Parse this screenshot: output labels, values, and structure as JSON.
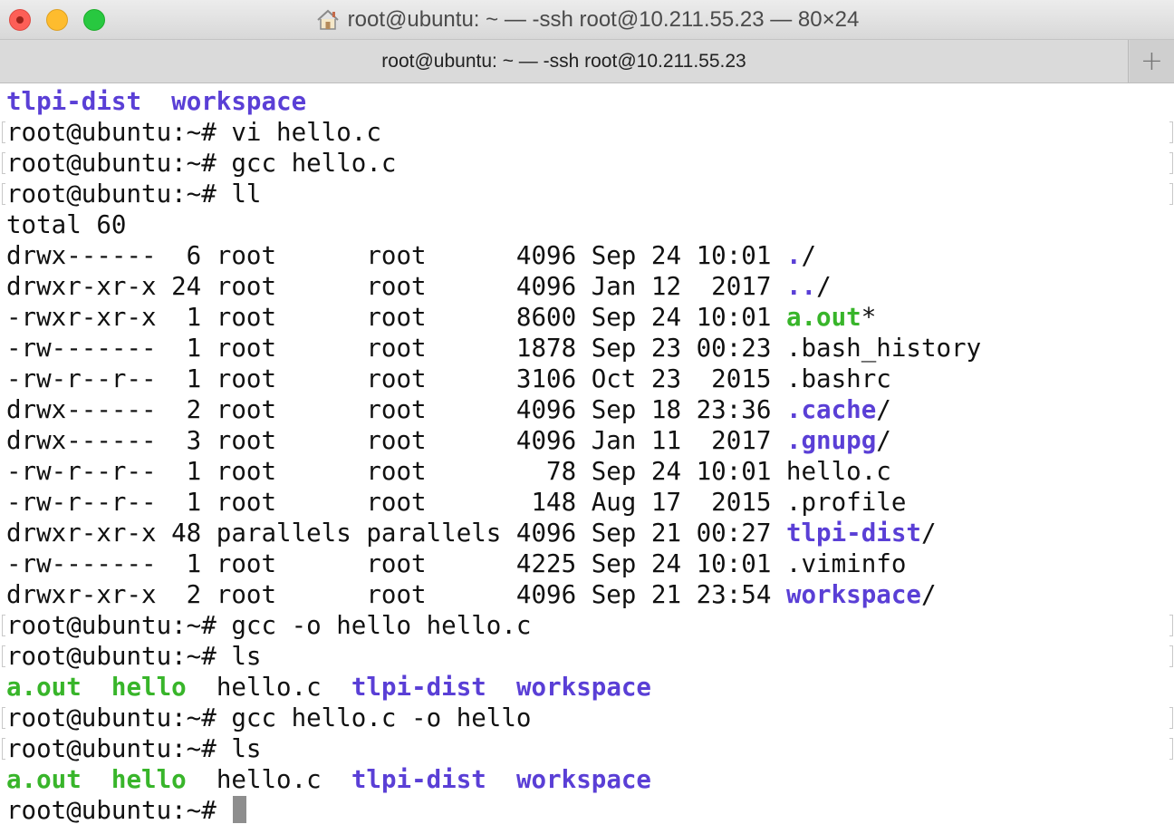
{
  "window": {
    "title": "root@ubuntu: ~ — -ssh root@10.211.55.23 — 80×24",
    "tab_label": "root@ubuntu: ~ — -ssh root@10.211.55.23",
    "new_tab_label": "+"
  },
  "colors": {
    "directory": "#5a3fd6",
    "executable": "#38b52a",
    "text": "#111111"
  },
  "terminal": {
    "lines": [
      {
        "marks": false,
        "segments": [
          {
            "t": "tlpi-dist",
            "c": "blue"
          },
          {
            "t": "  "
          },
          {
            "t": "workspace",
            "c": "blue"
          }
        ]
      },
      {
        "marks": true,
        "segments": [
          {
            "t": "root@ubuntu:~# vi hello.c"
          }
        ]
      },
      {
        "marks": true,
        "segments": [
          {
            "t": "root@ubuntu:~# gcc hello.c"
          }
        ]
      },
      {
        "marks": true,
        "segments": [
          {
            "t": "root@ubuntu:~# ll"
          }
        ]
      },
      {
        "marks": false,
        "segments": [
          {
            "t": "total 60"
          }
        ]
      },
      {
        "marks": false,
        "segments": [
          {
            "t": "drwx------  6 root      root      4096 Sep 24 10:01 "
          },
          {
            "t": ".",
            "c": "blue"
          },
          {
            "t": "/"
          }
        ]
      },
      {
        "marks": false,
        "segments": [
          {
            "t": "drwxr-xr-x 24 root      root      4096 Jan 12  2017 "
          },
          {
            "t": "..",
            "c": "blue"
          },
          {
            "t": "/"
          }
        ]
      },
      {
        "marks": false,
        "segments": [
          {
            "t": "-rwxr-xr-x  1 root      root      8600 Sep 24 10:01 "
          },
          {
            "t": "a.out",
            "c": "green"
          },
          {
            "t": "*"
          }
        ]
      },
      {
        "marks": false,
        "segments": [
          {
            "t": "-rw-------  1 root      root      1878 Sep 23 00:23 .bash_history"
          }
        ]
      },
      {
        "marks": false,
        "segments": [
          {
            "t": "-rw-r--r--  1 root      root      3106 Oct 23  2015 .bashrc"
          }
        ]
      },
      {
        "marks": false,
        "segments": [
          {
            "t": "drwx------  2 root      root      4096 Sep 18 23:36 "
          },
          {
            "t": ".cache",
            "c": "blue"
          },
          {
            "t": "/"
          }
        ]
      },
      {
        "marks": false,
        "segments": [
          {
            "t": "drwx------  3 root      root      4096 Jan 11  2017 "
          },
          {
            "t": ".gnupg",
            "c": "blue"
          },
          {
            "t": "/"
          }
        ]
      },
      {
        "marks": false,
        "segments": [
          {
            "t": "-rw-r--r--  1 root      root        78 Sep 24 10:01 hello.c"
          }
        ]
      },
      {
        "marks": false,
        "segments": [
          {
            "t": "-rw-r--r--  1 root      root       148 Aug 17  2015 .profile"
          }
        ]
      },
      {
        "marks": false,
        "segments": [
          {
            "t": "drwxr-xr-x 48 parallels parallels 4096 Sep 21 00:27 "
          },
          {
            "t": "tlpi-dist",
            "c": "blue"
          },
          {
            "t": "/"
          }
        ]
      },
      {
        "marks": false,
        "segments": [
          {
            "t": "-rw-------  1 root      root      4225 Sep 24 10:01 .viminfo"
          }
        ]
      },
      {
        "marks": false,
        "segments": [
          {
            "t": "drwxr-xr-x  2 root      root      4096 Sep 21 23:54 "
          },
          {
            "t": "workspace",
            "c": "blue"
          },
          {
            "t": "/"
          }
        ]
      },
      {
        "marks": true,
        "segments": [
          {
            "t": "root@ubuntu:~# gcc -o hello hello.c"
          }
        ]
      },
      {
        "marks": true,
        "segments": [
          {
            "t": "root@ubuntu:~# ls"
          }
        ]
      },
      {
        "marks": false,
        "segments": [
          {
            "t": "a.out",
            "c": "green"
          },
          {
            "t": "  "
          },
          {
            "t": "hello",
            "c": "green"
          },
          {
            "t": "  hello.c  "
          },
          {
            "t": "tlpi-dist",
            "c": "blue"
          },
          {
            "t": "  "
          },
          {
            "t": "workspace",
            "c": "blue"
          }
        ]
      },
      {
        "marks": true,
        "segments": [
          {
            "t": "root@ubuntu:~# gcc hello.c -o hello"
          }
        ]
      },
      {
        "marks": true,
        "segments": [
          {
            "t": "root@ubuntu:~# ls"
          }
        ]
      },
      {
        "marks": false,
        "segments": [
          {
            "t": "a.out",
            "c": "green"
          },
          {
            "t": "  "
          },
          {
            "t": "hello",
            "c": "green"
          },
          {
            "t": "  hello.c  "
          },
          {
            "t": "tlpi-dist",
            "c": "blue"
          },
          {
            "t": "  "
          },
          {
            "t": "workspace",
            "c": "blue"
          }
        ]
      },
      {
        "marks": false,
        "cursor": true,
        "segments": [
          {
            "t": "root@ubuntu:~# "
          }
        ]
      }
    ]
  }
}
